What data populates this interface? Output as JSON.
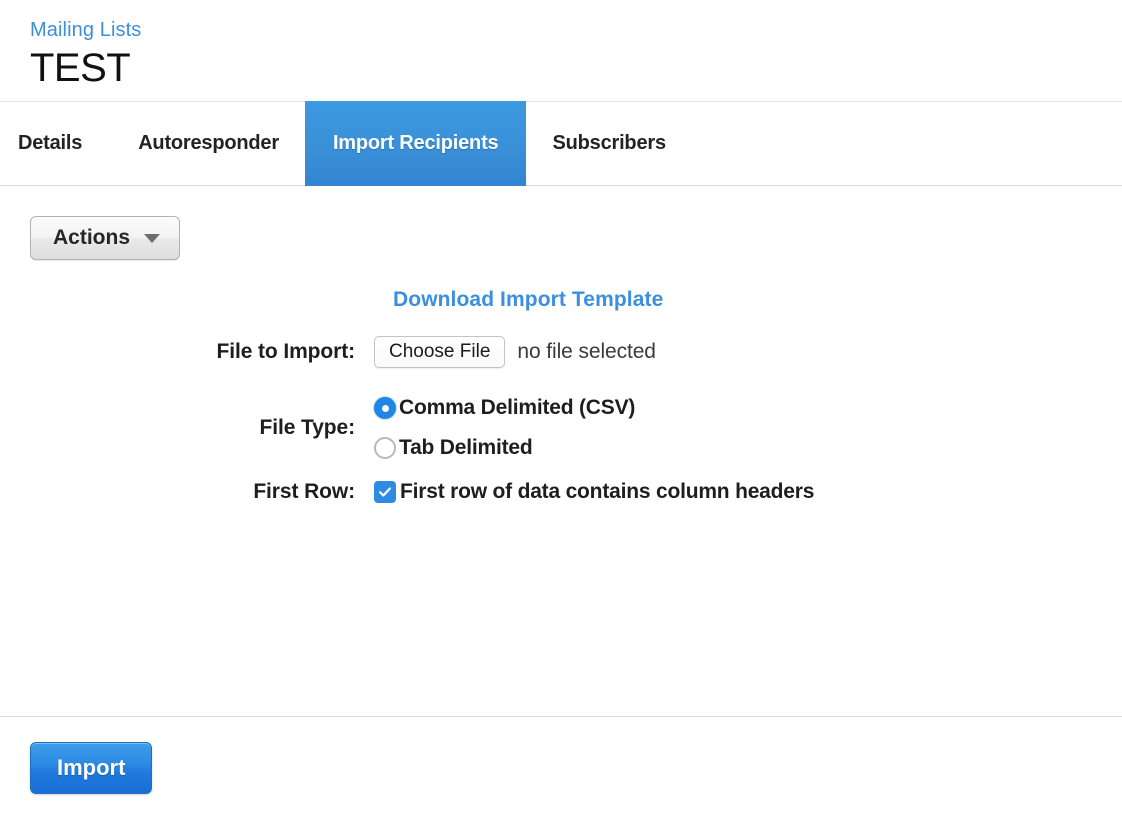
{
  "header": {
    "breadcrumb": "Mailing Lists",
    "title": "TEST"
  },
  "tabs": [
    {
      "label": "Details",
      "active": false
    },
    {
      "label": "Autoresponder",
      "active": false
    },
    {
      "label": "Import Recipients",
      "active": true
    },
    {
      "label": "Subscribers",
      "active": false
    }
  ],
  "toolbar": {
    "actions_label": "Actions",
    "caret_icon": "chevron-down-icon"
  },
  "form": {
    "template_link": "Download Import Template",
    "file_label": "File to Import:",
    "choose_file_button": "Choose File",
    "file_status": "no file selected",
    "file_type_label": "File Type:",
    "file_type_options": [
      {
        "label": "Comma Delimited (CSV)",
        "selected": true
      },
      {
        "label": "Tab Delimited",
        "selected": false
      }
    ],
    "first_row_label": "First Row:",
    "first_row_option": {
      "label": "First row of data contains column headers",
      "checked": true
    }
  },
  "footer": {
    "import_button": "Import"
  },
  "colors": {
    "link_blue": "#3b8fdd",
    "active_tab_blue": "#3a90d8",
    "primary_button_blue": "#2c8ae2",
    "control_blue": "#1e87e5",
    "text_dark": "#1e1e1e",
    "border_gray": "#dddddd"
  }
}
